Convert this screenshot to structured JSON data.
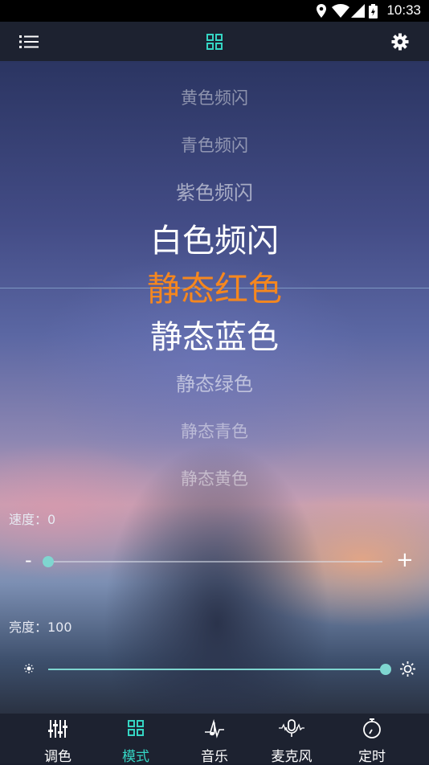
{
  "status_bar": {
    "time": "10:33"
  },
  "toolbar": {
    "menu_icon": "list-icon",
    "center_icon": "grid-icon",
    "settings_icon": "gear-icon"
  },
  "mode_picker": {
    "items": [
      {
        "label": "黄色频闪",
        "state": "far"
      },
      {
        "label": "青色频闪",
        "state": "far"
      },
      {
        "label": "紫色频闪",
        "state": "near"
      },
      {
        "label": "白色频闪",
        "state": "adjacent"
      },
      {
        "label": "静态红色",
        "state": "selected"
      },
      {
        "label": "静态蓝色",
        "state": "adjacent"
      },
      {
        "label": "静态绿色",
        "state": "near"
      },
      {
        "label": "静态青色",
        "state": "far"
      },
      {
        "label": "静态黄色",
        "state": "far"
      }
    ],
    "selected_color": "#f5871f"
  },
  "speed": {
    "label": "速度：0",
    "value": 0,
    "max": 100,
    "minus": "-",
    "plus": "+"
  },
  "brightness": {
    "label": "亮度：100",
    "value": 100,
    "max": 100
  },
  "accent_color": "#7fd6d0",
  "bottom_nav": {
    "items": [
      {
        "label": "调色",
        "icon": "sliders-icon"
      },
      {
        "label": "模式",
        "icon": "grid-icon",
        "active": true
      },
      {
        "label": "音乐",
        "icon": "music-note-icon"
      },
      {
        "label": "麦克风",
        "icon": "microphone-icon"
      },
      {
        "label": "定时",
        "icon": "timer-icon"
      }
    ],
    "active_color": "#35d6c4"
  }
}
